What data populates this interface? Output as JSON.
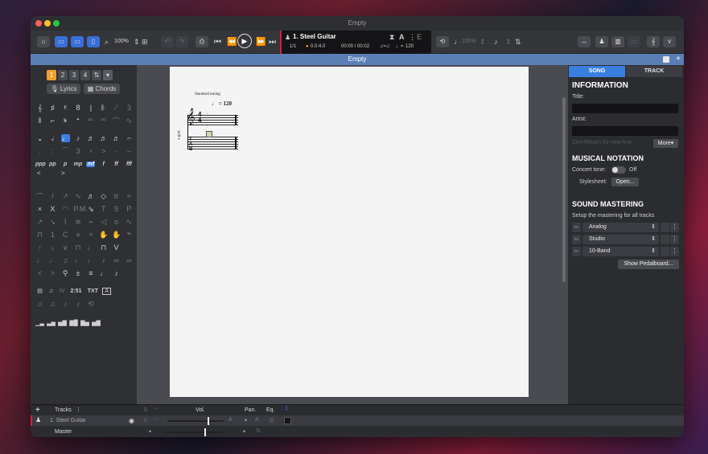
{
  "window": {
    "title": "Empty"
  },
  "toolbar": {
    "zoom": "100%",
    "track_name": "1. Steel Guitar",
    "lcd_bar": "1/1",
    "lcd_position": "0.0:4.0",
    "lcd_time": "00:00 / 00:02",
    "lcd_tempo": "120",
    "lcd_key": "E",
    "speed": "100%"
  },
  "docbar": {
    "title": "Empty"
  },
  "left_panel": {
    "voices": [
      "1",
      "2",
      "3",
      "4"
    ],
    "lyrics_label": "Lyrics",
    "chords_label": "Chords",
    "text_items": [
      "2:51",
      "TXT",
      "A"
    ]
  },
  "score": {
    "tuning": "Standard tuning",
    "tempo": "= 120",
    "track_abbr": "s.guit."
  },
  "right_panel": {
    "tabs": [
      "SONG",
      "TRACK"
    ],
    "information_title": "INFORMATION",
    "title_label": "Title:",
    "artist_label": "Artist:",
    "hint": "Ctrl+Return for new line.",
    "more_button": "More",
    "notation_title": "MUSICAL NOTATION",
    "concert_tone_label": "Concert tone:",
    "concert_tone_value": "Off",
    "stylesheet_label": "Stylesheet:",
    "stylesheet_button": "Open...",
    "mastering_title": "SOUND MASTERING",
    "mastering_desc": "Setup the mastering for all tracks",
    "presets": [
      "Analog",
      "Studio",
      "10-Band"
    ],
    "pedalboard_button": "Show Pedalboard..."
  },
  "bottom": {
    "tracks_label": "Tracks",
    "vol_label": "Vol.",
    "pan_label": "Pan.",
    "eq_label": "Eq.",
    "bar_number": "1",
    "track_row": "1. Steel Guitar",
    "master_row": "Master"
  },
  "colors": {
    "accent": "#3a7fe0",
    "track_marker": "#d02040",
    "docbar": "#5b7fb5"
  }
}
